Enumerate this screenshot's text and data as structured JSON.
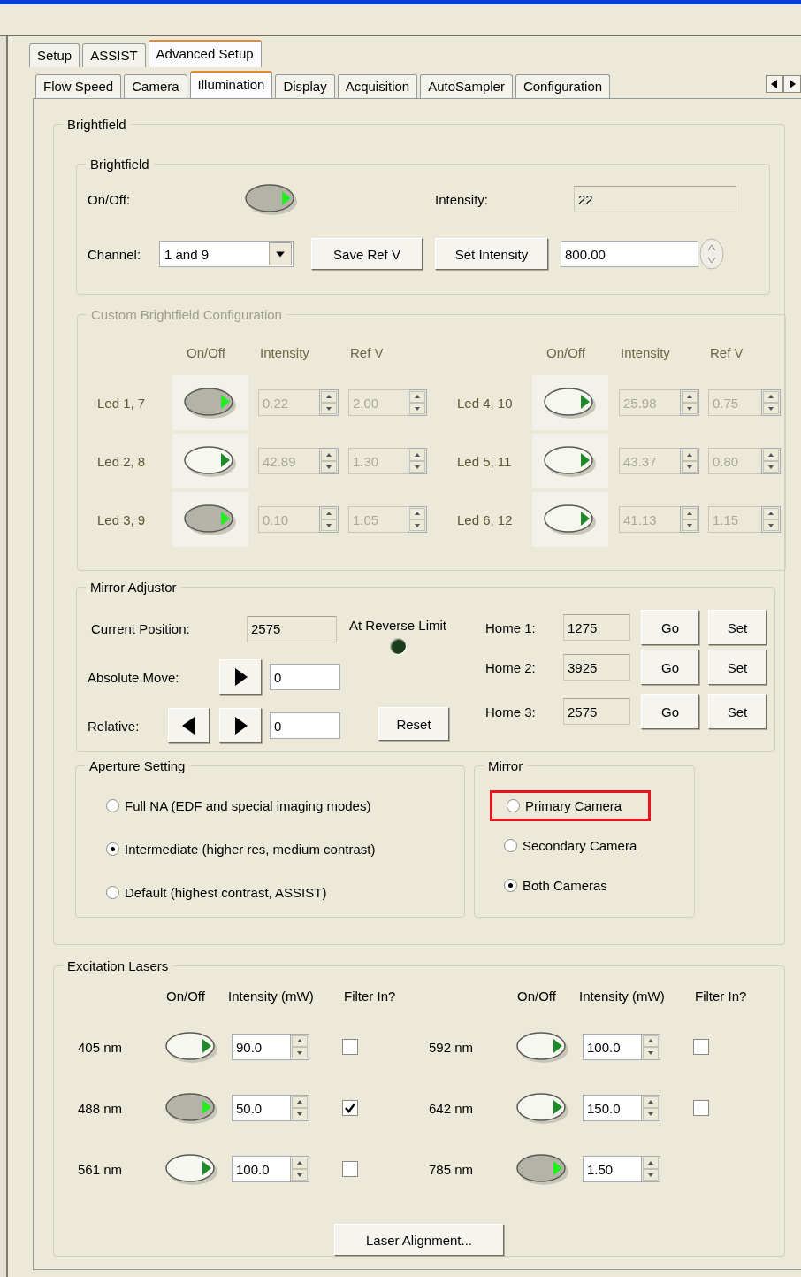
{
  "top_tabs": [
    {
      "label": "Setup",
      "selected": false
    },
    {
      "label": "ASSIST",
      "selected": false
    },
    {
      "label": "Advanced Setup",
      "selected": true
    }
  ],
  "sub_tabs": [
    {
      "label": "Flow Speed",
      "selected": false
    },
    {
      "label": "Camera",
      "selected": false
    },
    {
      "label": "Illumination",
      "selected": true
    },
    {
      "label": "Display",
      "selected": false
    },
    {
      "label": "Acquisition",
      "selected": false
    },
    {
      "label": "AutoSampler",
      "selected": false
    },
    {
      "label": "Configuration",
      "selected": false
    }
  ],
  "brightfield": {
    "title": "Brightfield",
    "control": {
      "title": "Brightfield",
      "on_off_label": "On/Off:",
      "on": true,
      "intensity_label": "Intensity:",
      "intensity": "22",
      "channel_label": "Channel:",
      "channel": "1 and 9",
      "buttons": [
        "Save Ref V",
        "Set Intensity"
      ],
      "value": "800.00"
    },
    "custom": {
      "title": "Custom Brightfield Configuration",
      "disabled": true,
      "columns": [
        {
          "headers": [
            "On/Off",
            "Intensity",
            "Ref V"
          ],
          "leds": [
            {
              "name": "Led 1, 7",
              "on": true,
              "intensity": "0.22",
              "ref_v": "2.00"
            },
            {
              "name": "Led 2, 8",
              "on": false,
              "intensity": "42.89",
              "ref_v": "1.30"
            },
            {
              "name": "Led 3, 9",
              "on": true,
              "intensity": "0.10",
              "ref_v": "1.05"
            }
          ]
        },
        {
          "headers": [
            "On/Off",
            "Intensity",
            "Ref V"
          ],
          "leds": [
            {
              "name": "Led 4, 10",
              "on": false,
              "intensity": "25.98",
              "ref_v": "0.75"
            },
            {
              "name": "Led 5, 11",
              "on": false,
              "intensity": "43.37",
              "ref_v": "0.80"
            },
            {
              "name": "Led 6, 12",
              "on": false,
              "intensity": "41.13",
              "ref_v": "1.15"
            }
          ]
        }
      ]
    },
    "mirror_adjustor": {
      "title": "Mirror Adjustor",
      "current_label": "Current Position:",
      "current": "2575",
      "limit_label": "At Reverse Limit",
      "limit_lit": false,
      "absolute_label": "Absolute Move:",
      "absolute": "0",
      "relative_label": "Relative:",
      "relative": "0",
      "reset": "Reset",
      "homes": [
        {
          "label": "Home 1:",
          "value": "1275",
          "go": "Go",
          "set": "Set"
        },
        {
          "label": "Home 2:",
          "value": "3925",
          "go": "Go",
          "set": "Set"
        },
        {
          "label": "Home 3:",
          "value": "2575",
          "go": "Go",
          "set": "Set"
        }
      ]
    },
    "aperture": {
      "title": "Aperture Setting",
      "options": [
        {
          "label": "Full NA (EDF and special imaging modes)",
          "selected": false
        },
        {
          "label": "Intermediate (higher res, medium contrast)",
          "selected": true
        },
        {
          "label": "Default (highest contrast, ASSIST)",
          "selected": false
        }
      ]
    },
    "mirror": {
      "title": "Mirror",
      "options": [
        {
          "label": "Primary Camera",
          "selected": false,
          "highlighted": true
        },
        {
          "label": "Secondary Camera",
          "selected": false,
          "highlighted": false
        },
        {
          "label": "Both Cameras",
          "selected": true,
          "highlighted": false
        }
      ]
    }
  },
  "lasers": {
    "title": "Excitation Lasers",
    "columns": [
      {
        "headers": [
          "On/Off",
          "Intensity (mW)",
          "Filter In?"
        ],
        "rows": [
          {
            "name": "405 nm",
            "on": false,
            "intensity": "90.0",
            "filter": false
          },
          {
            "name": "488 nm",
            "on": true,
            "intensity": "50.0",
            "filter": true
          },
          {
            "name": "561 nm",
            "on": false,
            "intensity": "100.0",
            "filter": false
          }
        ]
      },
      {
        "headers": [
          "On/Off",
          "Intensity (mW)",
          "Filter In?"
        ],
        "rows": [
          {
            "name": "592 nm",
            "on": false,
            "intensity": "100.0",
            "filter": false
          },
          {
            "name": "642 nm",
            "on": false,
            "intensity": "150.0",
            "filter": false
          },
          {
            "name": "785 nm",
            "on": true,
            "intensity": "1.50"
          }
        ]
      }
    ],
    "button": "Laser Alignment..."
  }
}
